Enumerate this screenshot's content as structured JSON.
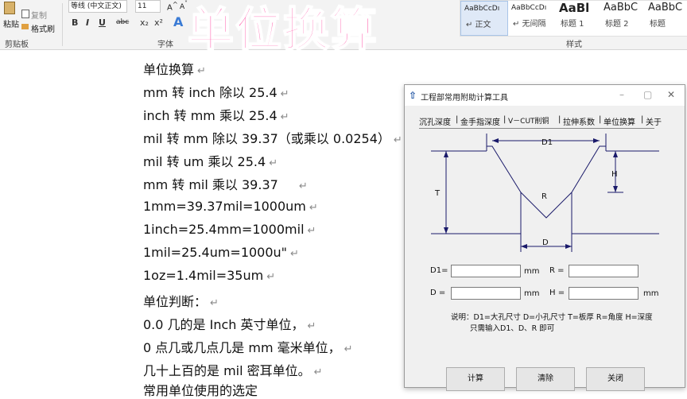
{
  "ribbon": {
    "clipboard": {
      "paste_label": "粘贴",
      "copy_label": "复制",
      "format_painter_label": "格式刷",
      "group_label": "剪贴板"
    },
    "font": {
      "font_name": "等线 (中文正文)",
      "font_size": "11",
      "group_label": "字体",
      "bold": "B",
      "italic": "I",
      "underline": "U",
      "strike": "abc",
      "subscript": "x₂",
      "superscript": "x²",
      "text_effect": "A"
    },
    "styles": {
      "group_label": "样式",
      "items": [
        {
          "sample": "AaBbCcDı",
          "name": "↵ 正文"
        },
        {
          "sample": "AaBbCcDı",
          "name": "↵ 无间隔"
        },
        {
          "sample": "AaBl",
          "name": "标题 1"
        },
        {
          "sample": "AaBbC",
          "name": "标题 2"
        },
        {
          "sample": "AaBbC",
          "name": "标题"
        }
      ]
    }
  },
  "banner_title": "单位换算",
  "document": {
    "paragraph_mark": "↵",
    "lines": [
      "单位换算",
      "mm 转 inch 除以 25.4",
      "inch 转 mm 乘以 25.4",
      "mil 转 mm 除以 39.37（或乘以 0.0254）",
      "mil 转 um 乘以 25.4",
      "mm 转 mil 乘以 39.37",
      "1mm=39.37mil=1000um",
      "1inch=25.4mm=1000mil",
      "1mil=25.4um=1000u\"",
      "1oz=1.4mil=35um",
      "单位判断：",
      "0.0 几的是 Inch 英寸单位，",
      "0 点几或几点几是 mm 毫米单位，",
      "几十上百的是 mil 密耳单位。",
      "常用单位使用的选定"
    ]
  },
  "dialog": {
    "title": "工程部常用附助计算工具",
    "tabs": [
      "沉孔深度",
      "金手指深度",
      "V－CUT削铜",
      "拉伸系数",
      "单位换算",
      "关于"
    ],
    "active_tab": "沉孔深度",
    "diagram": {
      "d1": "D1",
      "h": "H",
      "t": "T",
      "r": "R",
      "d": "D"
    },
    "fields": {
      "d1_label": "D1=",
      "r_label": "R =",
      "d_label": "D =",
      "h_label": "H =",
      "unit_mm": "mm"
    },
    "note_line1": "说明：D1=大孔尺寸 D=小孔尺寸 T=板厚 R=角度 H=深度",
    "note_line2": "只需输入D1、D、R 即可",
    "buttons": {
      "calc": "计算",
      "clear": "清除",
      "close": "关闭"
    }
  }
}
